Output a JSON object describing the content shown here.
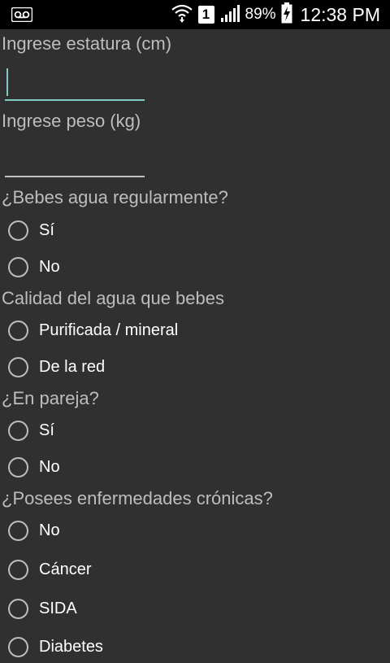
{
  "status_bar": {
    "icons": [
      "voicemail-icon",
      "wifi-icon",
      "sim-1-icon",
      "signal-icon",
      "battery-charging-icon"
    ],
    "sim_label": "1",
    "battery": "89%",
    "time": "12:38 PM"
  },
  "form": {
    "height_label": "Ingrese estatura (cm)",
    "height_value": "",
    "weight_label": "Ingrese peso (kg)",
    "weight_value": "",
    "q_water": {
      "label": "¿Bebes agua regularmente?",
      "options": [
        "Sí",
        "No"
      ]
    },
    "q_water_quality": {
      "label": "Calidad del agua que bebes",
      "options": [
        "Purificada / mineral",
        "De la red"
      ]
    },
    "q_partner": {
      "label": "¿En pareja?",
      "options": [
        "Sí",
        "No"
      ]
    },
    "q_chronic": {
      "label": "¿Posees enfermedades crónicas?",
      "options": [
        "No",
        "Cáncer",
        "SIDA",
        "Diabetes"
      ]
    }
  },
  "colors": {
    "background": "#303030",
    "accent": "#80cbc4",
    "label": "#bdbdbd"
  }
}
